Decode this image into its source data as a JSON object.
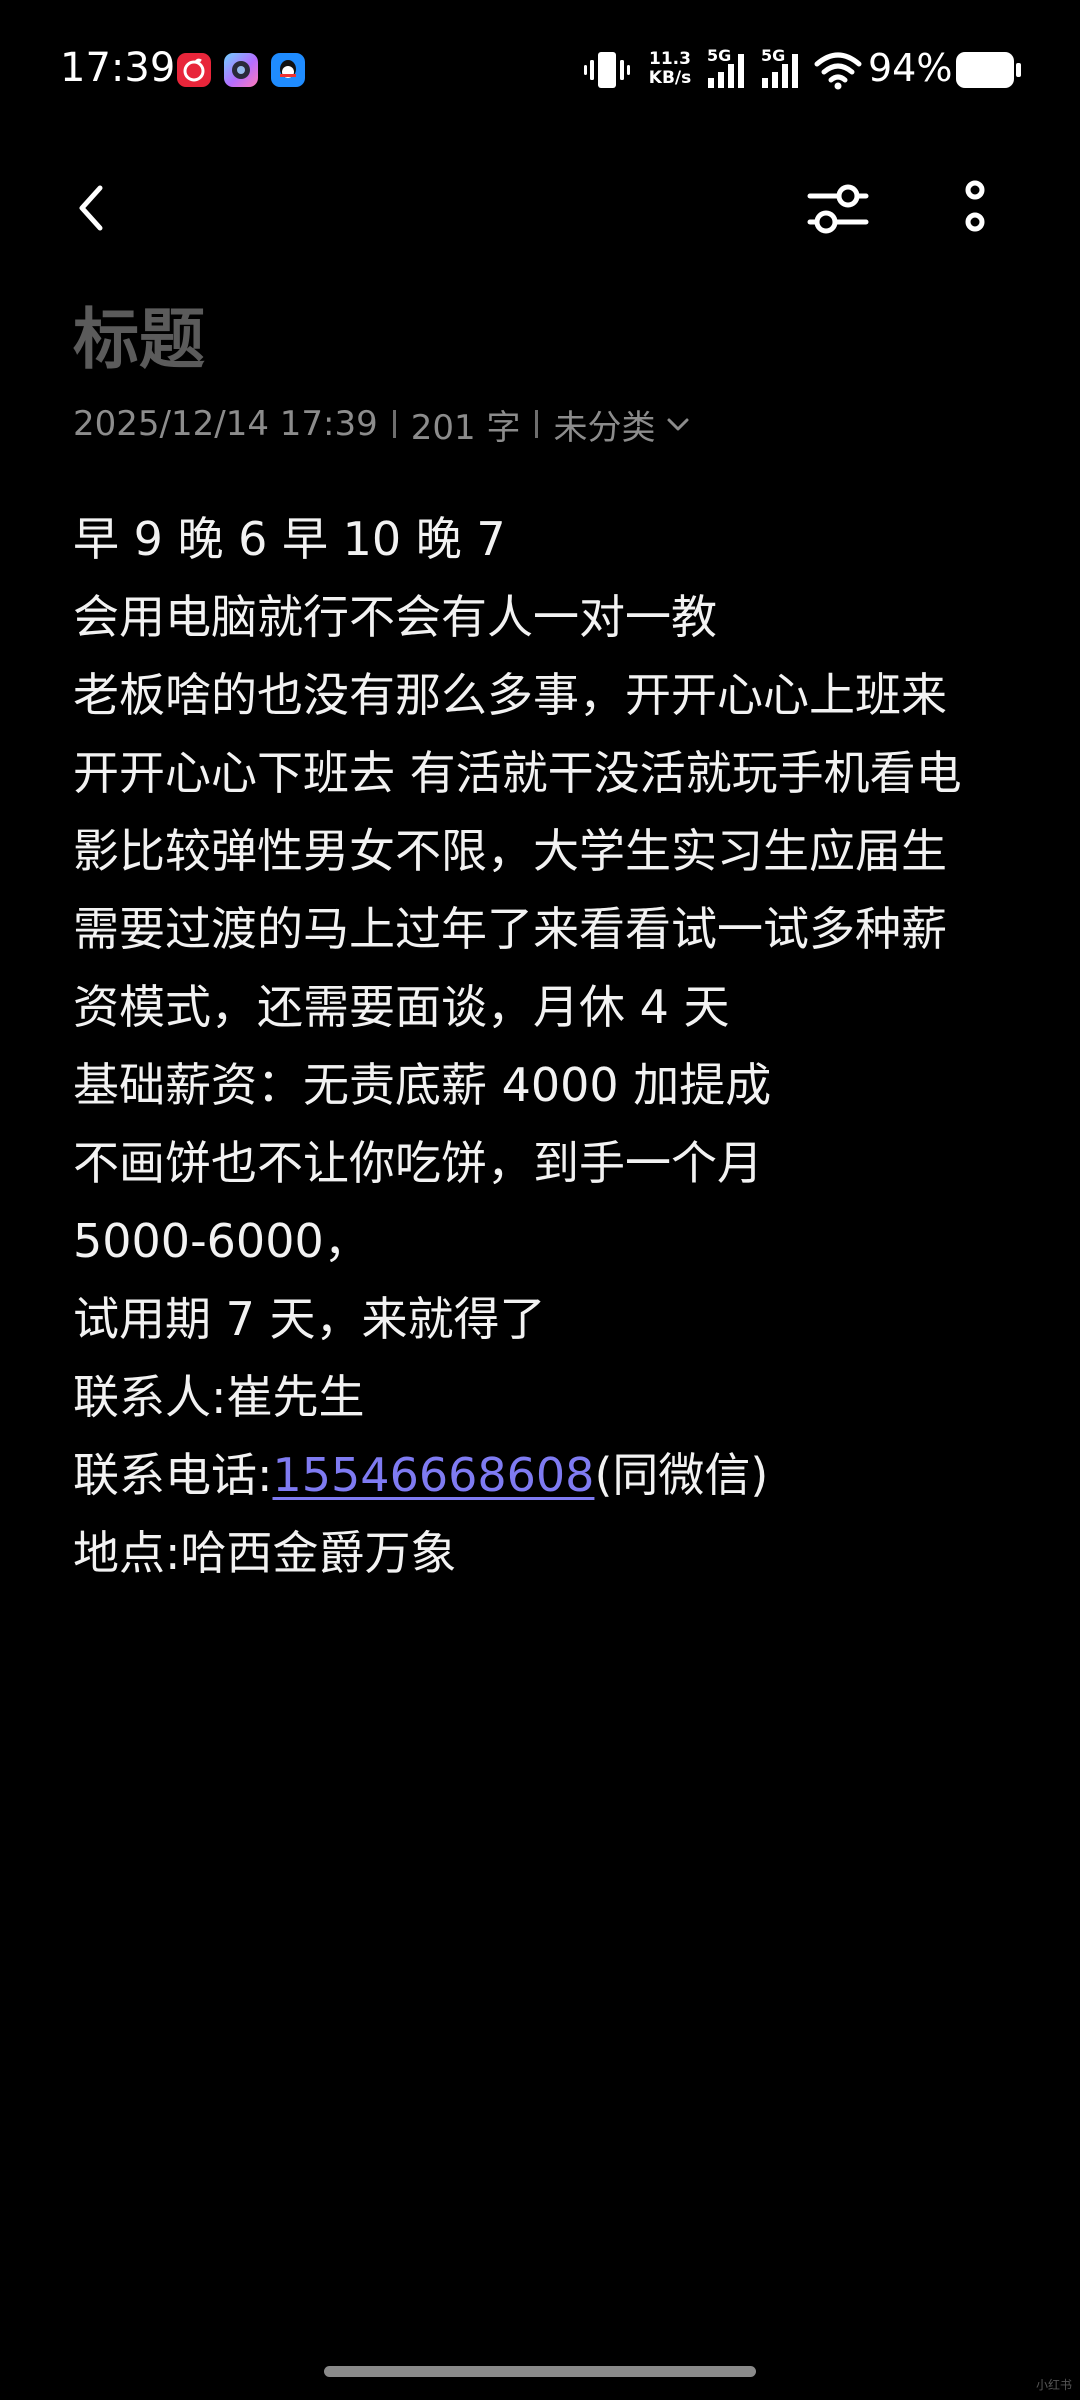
{
  "status_bar": {
    "time": "17:39",
    "apps": [
      "netease-music-icon",
      "camera-app-icon",
      "qq-icon"
    ],
    "net_speed_value": "11.3",
    "net_speed_unit": "KB/s",
    "signal_1_label": "5G",
    "signal_2_label": "5G",
    "battery_percent": "94%"
  },
  "toolbar": {
    "back_icon": "chevron-left-icon",
    "filter_icon": "sliders-icon",
    "more_icon": "more-vertical-icon"
  },
  "note": {
    "title": "标题",
    "date": "2025/12/14 17:39",
    "word_count": "201 字",
    "category": "未分类",
    "lines": {
      "l1": "早 9 晚 6 早 10 晚 7",
      "l2": "会用电脑就行不会有人一对一教",
      "l3": "老板啥的也没有那么多事，开开心心上班来",
      "l4": "开开心心下班去 有活就干没活就玩手机看电",
      "l5": "影比较弹性男女不限，大学生实习生应届生",
      "l6": "需要过渡的马上过年了来看看试一试多种薪",
      "l7": "资模式，还需要面谈，月休 4 天",
      "l8": "基础薪资：无责底薪 4000 加提成",
      "l9": "不画饼也不让你吃饼，到手一个月",
      "l10": "5000-6000，",
      "l11": "试用期 7 天，来就得了",
      "l12": "联系人:崔先生",
      "l13_prefix": "联系电话:",
      "l13_phone": "15546668608",
      "l13_suffix": "(同微信)",
      "l14": "地点:哈西金爵万象"
    }
  },
  "colors": {
    "background": "#000000",
    "title": "#5b5b5b",
    "meta": "#8c8c8c",
    "body_text": "#f2f2f2",
    "link": "#7f7bf2"
  },
  "watermark": "小红书"
}
